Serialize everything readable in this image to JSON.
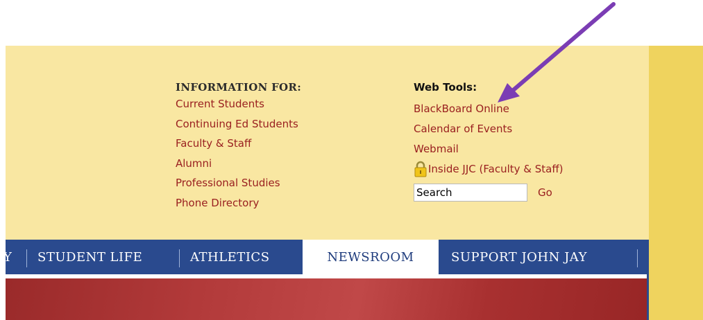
{
  "information_for": {
    "heading": "INFORMATION FOR:",
    "links": [
      "Current Students",
      "Continuing Ed Students",
      "Faculty & Staff",
      "Alumni",
      "Professional Studies",
      "Phone Directory"
    ]
  },
  "web_tools": {
    "heading": "Web Tools:",
    "links": [
      "BlackBoard Online",
      "Calendar of Events",
      "Webmail",
      "Inside JJC (Faculty & Staff)"
    ],
    "search_value": "Search",
    "go_label": "Go"
  },
  "nav": {
    "items": [
      "STUDENT LIFE",
      "ATHLETICS",
      "NEWSROOM",
      "SUPPORT JOHN JAY"
    ],
    "partial_left": "Y",
    "active": "NEWSROOM"
  },
  "colors": {
    "panel": "#f9e7a2",
    "accent_strip": "#efd35e",
    "link": "#9a2020",
    "nav_bg": "#2a4a8e",
    "annotation_arrow": "#7b3db4"
  },
  "icons": [
    "lock-icon",
    "annotation-arrow"
  ]
}
